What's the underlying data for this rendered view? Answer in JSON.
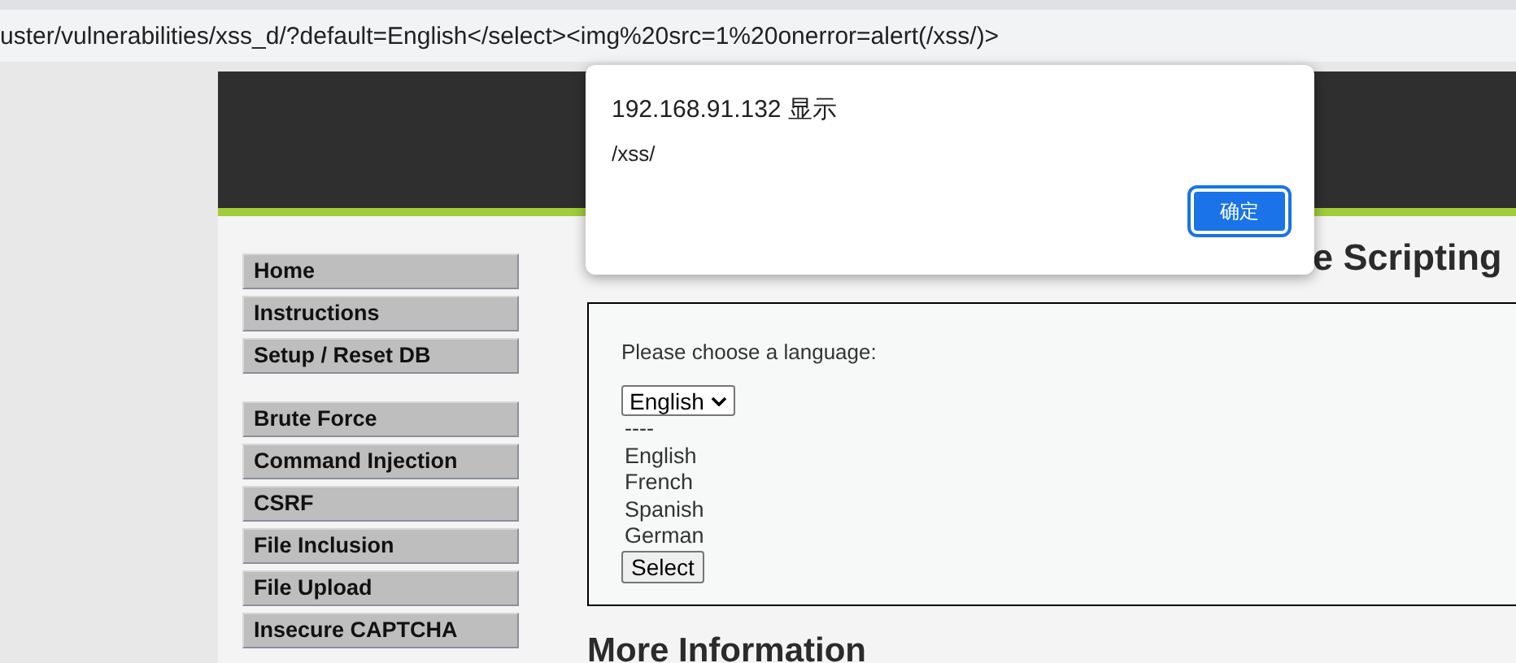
{
  "address_bar": {
    "url": "uster/vulnerabilities/xss_d/?default=English</select><img%20src=1%20onerror=alert(/xss/)>"
  },
  "dialog": {
    "title": "192.168.91.132 显示",
    "message": "/xss/",
    "button": "确定"
  },
  "menu": [
    [
      {
        "label": "Home"
      },
      {
        "label": "Instructions"
      },
      {
        "label": "Setup / Reset DB"
      }
    ],
    [
      {
        "label": "Brute Force"
      },
      {
        "label": "Command Injection"
      },
      {
        "label": "CSRF"
      },
      {
        "label": "File Inclusion"
      },
      {
        "label": "File Upload"
      },
      {
        "label": "Insecure CAPTCHA"
      }
    ]
  ],
  "heading": "e Scripting",
  "form": {
    "prompt": "Please choose a language:",
    "select_value": "English",
    "lines": [
      "----",
      "English",
      "French",
      "Spanish",
      "German"
    ],
    "button": "Select"
  },
  "section_heading": "More Information"
}
